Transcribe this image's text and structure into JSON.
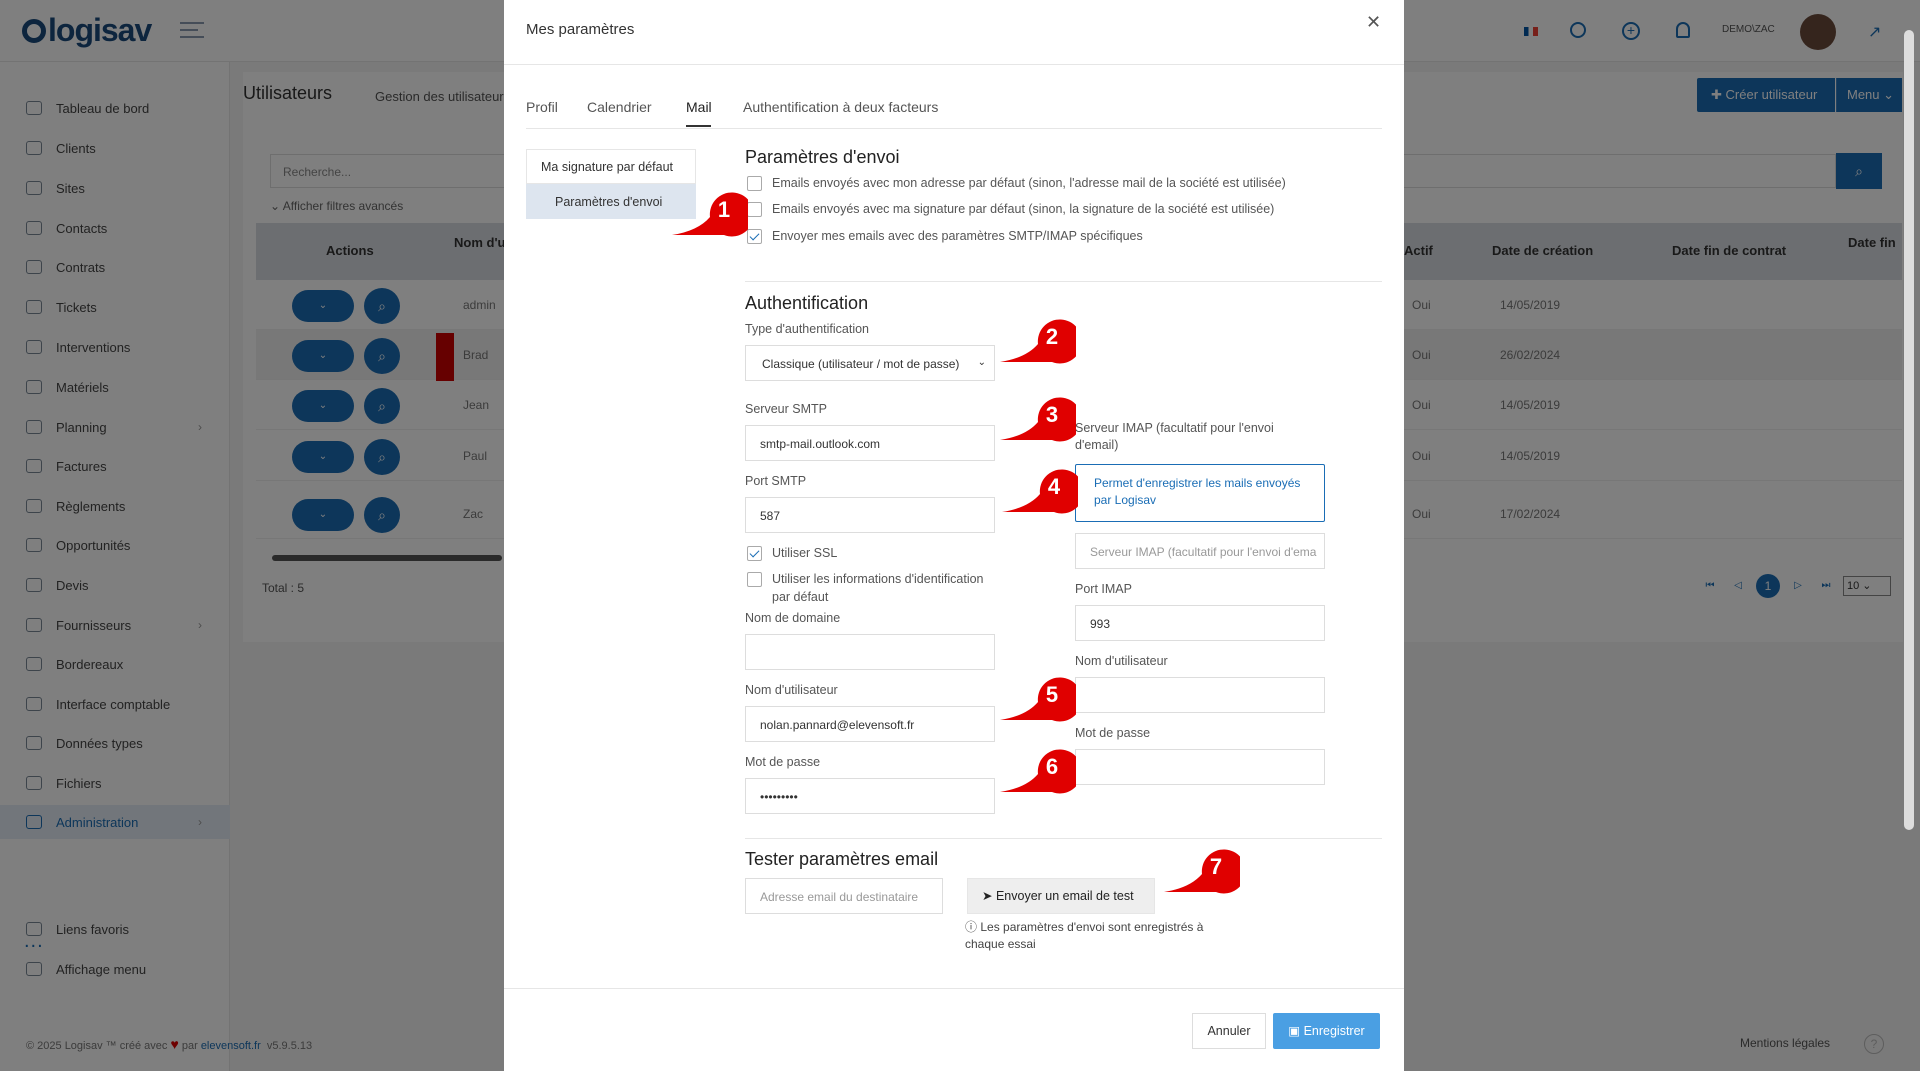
{
  "app": {
    "logo": "logisav",
    "user": "DEMO\\ZAC"
  },
  "sidebar": {
    "items": [
      {
        "label": "Tableau de bord"
      },
      {
        "label": "Clients"
      },
      {
        "label": "Sites"
      },
      {
        "label": "Contacts"
      },
      {
        "label": "Contrats"
      },
      {
        "label": "Tickets"
      },
      {
        "label": "Interventions"
      },
      {
        "label": "Matériels"
      },
      {
        "label": "Planning"
      },
      {
        "label": "Factures"
      },
      {
        "label": "Règlements"
      },
      {
        "label": "Opportunités"
      },
      {
        "label": "Devis"
      },
      {
        "label": "Fournisseurs"
      },
      {
        "label": "Bordereaux"
      },
      {
        "label": "Interface comptable"
      },
      {
        "label": "Données types"
      },
      {
        "label": "Fichiers"
      },
      {
        "label": "Administration"
      }
    ],
    "more": "...",
    "bottom": [
      {
        "label": "Liens favoris"
      },
      {
        "label": "Affichage menu"
      }
    ]
  },
  "page": {
    "title": "Utilisateurs",
    "subtitle": "Gestion des utilisateur",
    "create_button": "Créer utilisateur",
    "menu_button": "Menu",
    "search_placeholder": "Recherche...",
    "advanced_filters": "Afficher filtres avancés",
    "columns": {
      "actions": "Actions",
      "name": "Nom d'u",
      "actif": "Actif",
      "created": "Date de création",
      "contract_end": "Date fin de contrat",
      "identity_end": "Date fin identité"
    },
    "rows": [
      {
        "name": "admin",
        "actif": "Oui",
        "created": "14/05/2019"
      },
      {
        "name": "Brad",
        "actif": "Oui",
        "created": "26/02/2024"
      },
      {
        "name": "Jean",
        "actif": "Oui",
        "created": "14/05/2019"
      },
      {
        "name": "Paul",
        "actif": "Oui",
        "created": "14/05/2019"
      },
      {
        "name": "Zac",
        "actif": "Oui",
        "created": "17/02/2024"
      }
    ],
    "total": "Total : 5",
    "page_current": "1",
    "page_size": "10"
  },
  "footer": {
    "copyright": "© 2025 Logisav ™ créé avec",
    "by": "par",
    "company": "elevensoft.fr",
    "version": "v5.9.5.13",
    "legal": "Mentions légales"
  },
  "modal": {
    "title": "Mes paramètres",
    "tabs": [
      "Profil",
      "Calendrier",
      "Mail",
      "Authentification à deux facteurs"
    ],
    "subnav": [
      "Ma signature par défaut",
      "Paramètres d'envoi"
    ],
    "send": {
      "title": "Paramètres d'envoi",
      "opt1": "Emails envoyés avec mon adresse par défaut (sinon, l'adresse mail de la société est utilisée)",
      "opt2": "Emails envoyés avec ma signature par défaut (sinon, la signature de la société est utilisée)",
      "opt3": "Envoyer mes emails avec des paramètres SMTP/IMAP spécifiques"
    },
    "auth": {
      "title": "Authentification",
      "type_label": "Type d'authentification",
      "type_value": "Classique (utilisateur / mot de passe)",
      "smtp_label": "Serveur SMTP",
      "smtp_value": "smtp-mail.outlook.com",
      "port_label": "Port SMTP",
      "port_value": "587",
      "ssl_label": "Utiliser SSL",
      "default_creds_label": "Utiliser les informations d'identification par défaut",
      "domain_label": "Nom de domaine",
      "user_label": "Nom d'utilisateur",
      "user_value": "nolan.pannard@elevensoft.fr",
      "pass_label": "Mot de passe",
      "pass_value": "•••••••••",
      "imap_label": "Serveur IMAP (facultatif pour l'envoi d'email)",
      "imap_tooltip": "Permet d'enregistrer les mails envoyés par Logisav",
      "imap_placeholder": "Serveur IMAP (facultatif pour l'envoi d'ema",
      "imap_port_label": "Port IMAP",
      "imap_port_value": "993",
      "imap_user_label": "Nom d'utilisateur",
      "imap_pass_label": "Mot de passe"
    },
    "test": {
      "title": "Tester paramètres email",
      "placeholder": "Adresse email du destinataire",
      "button": "Envoyer un email de test",
      "info": "Les paramètres d'envoi sont enregistrés à chaque essai"
    },
    "cancel": "Annuler",
    "save": "Enregistrer"
  },
  "annotations": [
    "1",
    "2",
    "3",
    "4",
    "5",
    "6",
    "7"
  ],
  "colors": {
    "primary": "#1a6db5",
    "annotation": "#e00000",
    "save": "#4a9fe3"
  }
}
